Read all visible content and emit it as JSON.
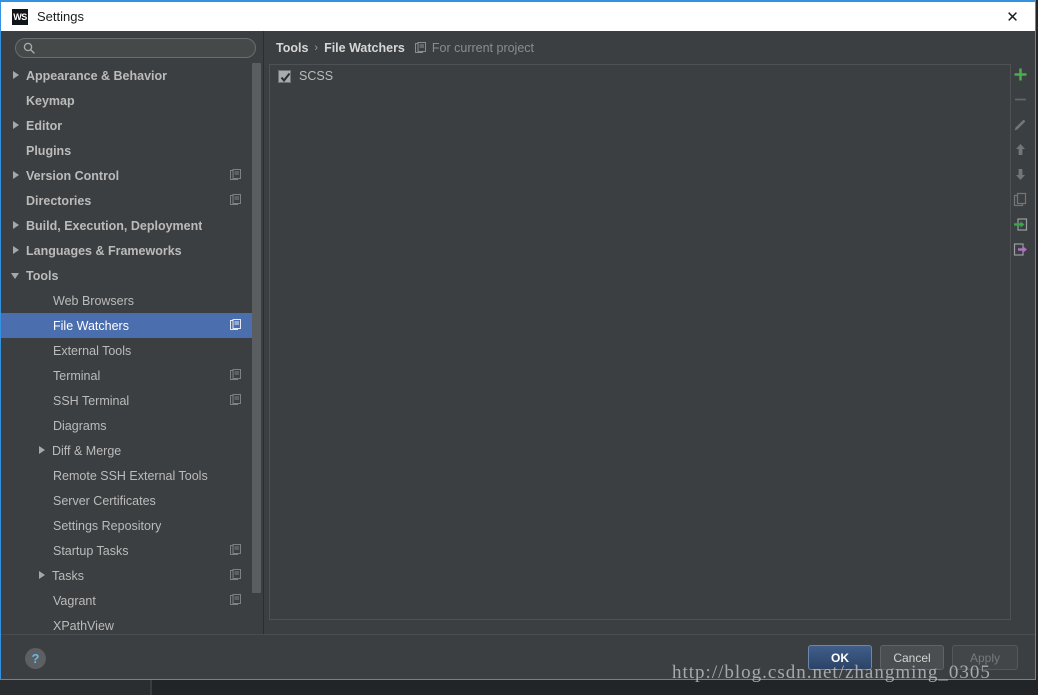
{
  "window": {
    "title": "Settings",
    "logo_text": "WS",
    "logo_name": "webstorm-logo",
    "close_label": "✕"
  },
  "search": {
    "value": "",
    "placeholder": "",
    "icon": "search-icon"
  },
  "sidebar": {
    "items": [
      {
        "label": "Appearance & Behavior",
        "arrow": "right",
        "bold": true,
        "indent": 10,
        "project_icon": false,
        "selected": false
      },
      {
        "label": "Keymap",
        "arrow": "none",
        "bold": true,
        "indent": 25,
        "project_icon": false,
        "selected": false
      },
      {
        "label": "Editor",
        "arrow": "right",
        "bold": true,
        "indent": 10,
        "project_icon": false,
        "selected": false
      },
      {
        "label": "Plugins",
        "arrow": "none",
        "bold": true,
        "indent": 25,
        "project_icon": false,
        "selected": false
      },
      {
        "label": "Version Control",
        "arrow": "right",
        "bold": true,
        "indent": 10,
        "project_icon": true,
        "selected": false
      },
      {
        "label": "Directories",
        "arrow": "none",
        "bold": true,
        "indent": 25,
        "project_icon": true,
        "selected": false
      },
      {
        "label": "Build, Execution, Deployment",
        "arrow": "right",
        "bold": true,
        "indent": 10,
        "project_icon": false,
        "selected": false
      },
      {
        "label": "Languages & Frameworks",
        "arrow": "right",
        "bold": true,
        "indent": 10,
        "project_icon": false,
        "selected": false
      },
      {
        "label": "Tools",
        "arrow": "down",
        "bold": true,
        "indent": 10,
        "project_icon": false,
        "selected": false
      },
      {
        "label": "Web Browsers",
        "arrow": "none",
        "bold": false,
        "indent": 52,
        "project_icon": false,
        "selected": false
      },
      {
        "label": "File Watchers",
        "arrow": "none",
        "bold": false,
        "indent": 52,
        "project_icon": true,
        "selected": true
      },
      {
        "label": "External Tools",
        "arrow": "none",
        "bold": false,
        "indent": 52,
        "project_icon": false,
        "selected": false
      },
      {
        "label": "Terminal",
        "arrow": "none",
        "bold": false,
        "indent": 52,
        "project_icon": true,
        "selected": false
      },
      {
        "label": "SSH Terminal",
        "arrow": "none",
        "bold": false,
        "indent": 52,
        "project_icon": true,
        "selected": false
      },
      {
        "label": "Diagrams",
        "arrow": "none",
        "bold": false,
        "indent": 52,
        "project_icon": false,
        "selected": false
      },
      {
        "label": "Diff & Merge",
        "arrow": "right",
        "bold": false,
        "indent": 36,
        "project_icon": false,
        "selected": false
      },
      {
        "label": "Remote SSH External Tools",
        "arrow": "none",
        "bold": false,
        "indent": 52,
        "project_icon": false,
        "selected": false
      },
      {
        "label": "Server Certificates",
        "arrow": "none",
        "bold": false,
        "indent": 52,
        "project_icon": false,
        "selected": false
      },
      {
        "label": "Settings Repository",
        "arrow": "none",
        "bold": false,
        "indent": 52,
        "project_icon": false,
        "selected": false
      },
      {
        "label": "Startup Tasks",
        "arrow": "none",
        "bold": false,
        "indent": 52,
        "project_icon": true,
        "selected": false
      },
      {
        "label": "Tasks",
        "arrow": "right",
        "bold": false,
        "indent": 36,
        "project_icon": true,
        "selected": false
      },
      {
        "label": "Vagrant",
        "arrow": "none",
        "bold": false,
        "indent": 52,
        "project_icon": true,
        "selected": false
      },
      {
        "label": "XPathView",
        "arrow": "none",
        "bold": false,
        "indent": 52,
        "project_icon": false,
        "selected": false
      }
    ]
  },
  "content": {
    "breadcrumb": {
      "root": "Tools",
      "separator": "›",
      "leaf": "File Watchers",
      "scope_icon": "project-scope-icon",
      "scope_text": "For current project"
    },
    "watchers": [
      {
        "name": "SCSS",
        "checked": true
      }
    ],
    "toolbar": [
      {
        "name": "add-button",
        "icon": "plus-icon",
        "enabled": true
      },
      {
        "name": "remove-button",
        "icon": "minus-icon",
        "enabled": false
      },
      {
        "name": "edit-button",
        "icon": "pencil-icon",
        "enabled": false
      },
      {
        "name": "move-up-button",
        "icon": "arrow-up-icon",
        "enabled": false
      },
      {
        "name": "move-down-button",
        "icon": "arrow-down-icon",
        "enabled": false
      },
      {
        "name": "copy-button",
        "icon": "copy-icon",
        "enabled": false
      },
      {
        "name": "import-button",
        "icon": "import-arrow-icon",
        "enabled": true
      },
      {
        "name": "export-button",
        "icon": "export-arrow-icon",
        "enabled": true
      }
    ]
  },
  "footer": {
    "help_label": "?",
    "ok_label": "OK",
    "cancel_label": "Cancel",
    "apply_label": "Apply"
  },
  "watermark": {
    "text": "http://blog.csdn.net/zhangming_0305"
  },
  "colors": {
    "panel_bg": "#3c3f41",
    "selection_blue": "#4b6eaf",
    "window_border": "#3592e0",
    "titlebar_bg": "#ffffff",
    "text": "#bbbbbb",
    "accent_green": "#4caf50",
    "accent_purple": "#b36ecb"
  }
}
